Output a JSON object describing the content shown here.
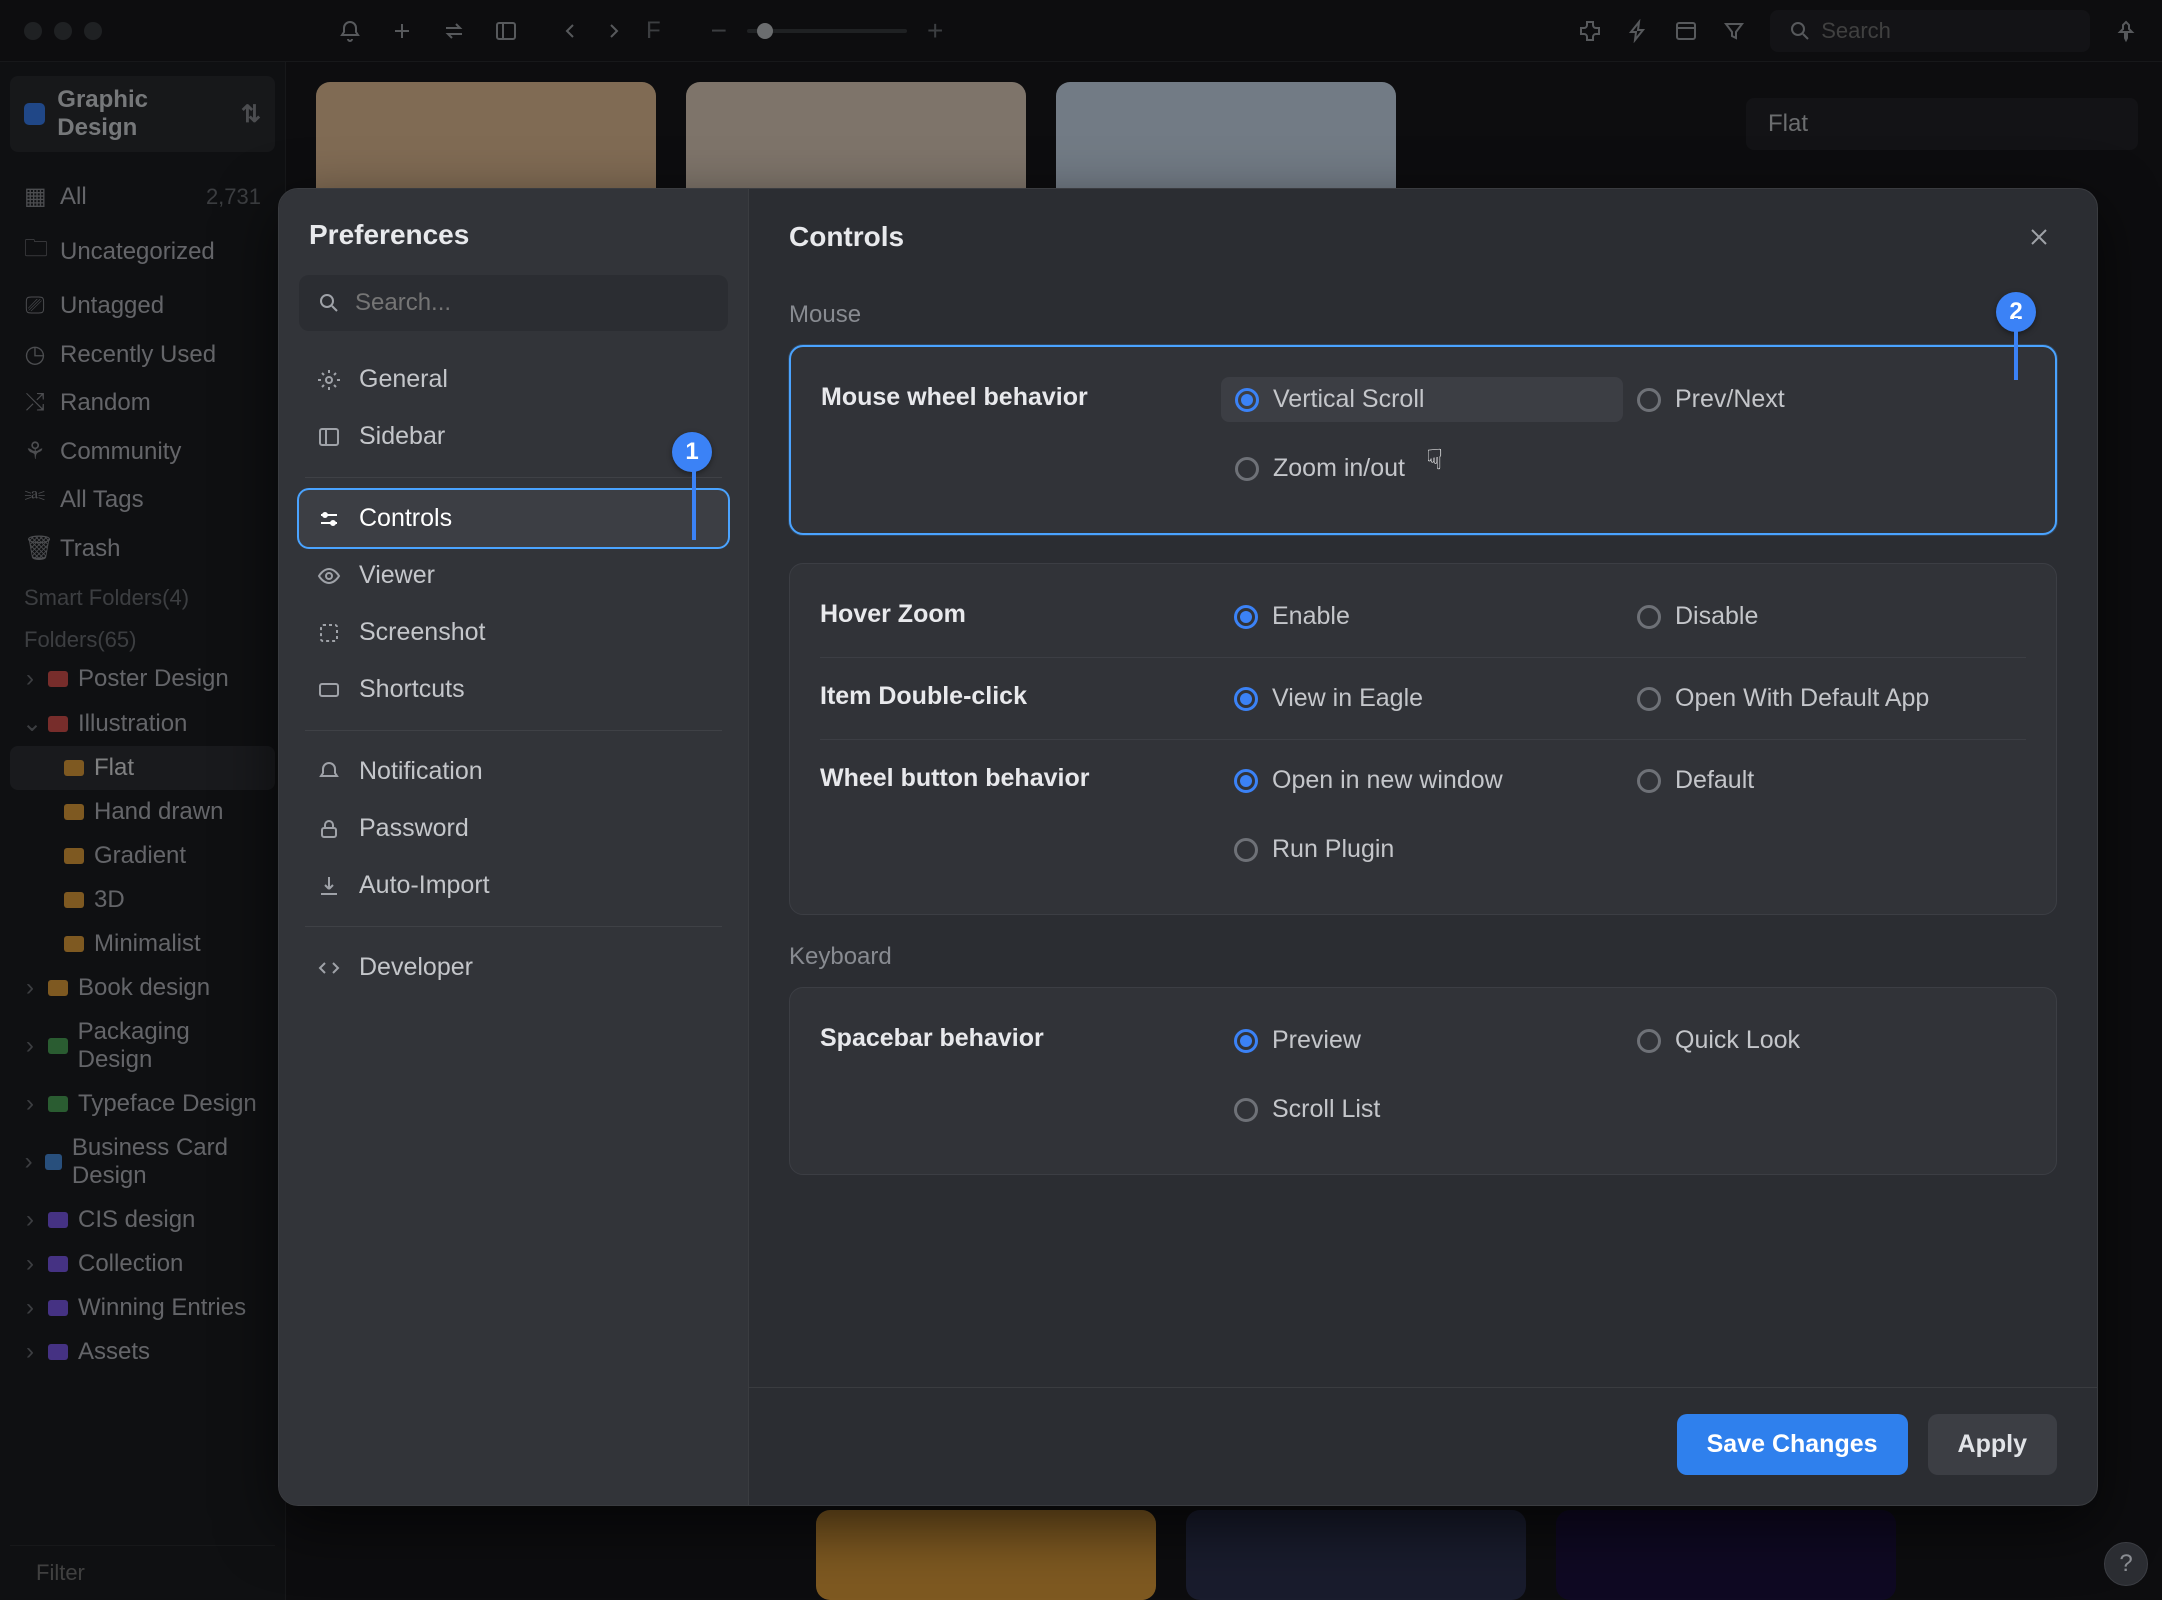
{
  "toolbar": {
    "search_placeholder": "Search"
  },
  "library": {
    "name": "Graphic Design"
  },
  "side_items": {
    "all": "All",
    "all_count": "2,731",
    "uncategorized": "Uncategorized",
    "untagged": "Untagged",
    "recent": "Recently Used",
    "random": "Random",
    "community": "Community",
    "all_tags": "All Tags",
    "trash": "Trash"
  },
  "side_sections": {
    "smart": "Smart Folders(4)",
    "folders": "Folders(65)"
  },
  "folders": {
    "poster": "Poster Design",
    "illustration": "Illustration",
    "flat": "Flat",
    "hand_drawn": "Hand drawn",
    "gradient": "Gradient",
    "threeD": "3D",
    "minimalist": "Minimalist",
    "book": "Book design",
    "packaging": "Packaging Design",
    "typeface": "Typeface Design",
    "bizcard": "Business Card Design",
    "cis": "CIS design",
    "collection": "Collection",
    "winning": "Winning Entries",
    "assets": "Assets"
  },
  "filter_placeholder": "Filter",
  "info_panel": {
    "title": "Flat"
  },
  "modal": {
    "title": "Preferences",
    "search_placeholder": "Search...",
    "nav": {
      "general": "General",
      "sidebar": "Sidebar",
      "controls": "Controls",
      "viewer": "Viewer",
      "screenshot": "Screenshot",
      "shortcuts": "Shortcuts",
      "notification": "Notification",
      "password": "Password",
      "auto_import": "Auto-Import",
      "developer": "Developer"
    },
    "panel_title": "Controls",
    "sections": {
      "mouse": "Mouse",
      "keyboard": "Keyboard"
    },
    "settings": {
      "mouse_wheel": {
        "label": "Mouse wheel behavior",
        "vertical": "Vertical Scroll",
        "prevnext": "Prev/Next",
        "zoom": "Zoom in/out"
      },
      "hover_zoom": {
        "label": "Hover Zoom",
        "enable": "Enable",
        "disable": "Disable"
      },
      "double_click": {
        "label": "Item Double-click",
        "eagle": "View in Eagle",
        "default_app": "Open With Default App"
      },
      "wheel_button": {
        "label": "Wheel button behavior",
        "new_window": "Open in new window",
        "default": "Default",
        "plugin": "Run Plugin"
      },
      "spacebar": {
        "label": "Spacebar behavior",
        "preview": "Preview",
        "quicklook": "Quick Look",
        "scroll": "Scroll List"
      }
    },
    "footer": {
      "save": "Save Changes",
      "apply": "Apply"
    },
    "badges": {
      "one": "1",
      "two": "2"
    }
  }
}
